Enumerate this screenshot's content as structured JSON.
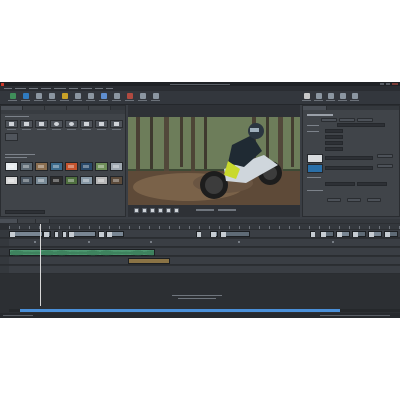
{
  "colors": {
    "window_bg": "#3a3e44",
    "title_bar": "#1f2226",
    "timeline_bg": "#2c2f33",
    "playhead": "#d8d8d8",
    "audio_clip": "#4f9a72",
    "text_clip": "#8a7345",
    "accent_blue": "#4a90d9"
  },
  "toolbar": {
    "icons": [
      "arrow-icon",
      "arrow-icon",
      "grid-icon",
      "grid-icon",
      "scissors-icon",
      "grid-icon",
      "grid-icon",
      "grid-icon",
      "grid-icon",
      "grid-icon",
      "grid-icon",
      "grid-icon",
      "circle-icon",
      "grid-icon",
      "grid-icon",
      "grid-icon",
      "grid-icon"
    ]
  },
  "media_pool": {
    "top_tiles": [
      "film-icon",
      "folder-icon",
      "clock-icon",
      "ring-icon",
      "ring-icon",
      "grid-icon",
      "grid-icon",
      "grid-icon"
    ]
  },
  "preview": {
    "transport_icons": [
      "play-icon",
      "stop-icon",
      "rewind-icon",
      "forward-icon",
      "marker-icon",
      "loop-icon"
    ]
  },
  "properties": {
    "swatches": [
      "#d9dcdf",
      "#2a6fa8"
    ]
  },
  "timeline": {
    "tracks": [
      {
        "type": "video"
      },
      {
        "type": "video"
      },
      {
        "type": "audio"
      },
      {
        "type": "text"
      },
      {
        "type": "empty"
      }
    ]
  }
}
